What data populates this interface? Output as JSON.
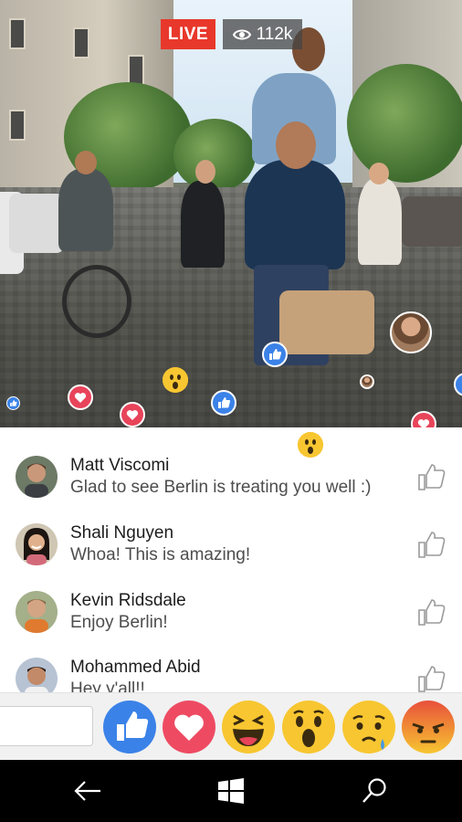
{
  "live": {
    "badge": "LIVE",
    "viewers": "112k"
  },
  "comments": [
    {
      "name": "Matt Viscomi",
      "text": "Glad to see Berlin is treating you well :)",
      "skin": "#c9987a",
      "hair": "#5a3b2a",
      "bg": "#6d7a66"
    },
    {
      "name": "Shali Nguyen",
      "text": "Whoa! This is amazing!",
      "skin": "#e0b08c",
      "hair": "#1c1410",
      "bg": "#cfc6b3"
    },
    {
      "name": "Kevin Ridsdale",
      "text": "Enjoy Berlin!",
      "skin": "#d4a584",
      "hair": "#8a6a4a",
      "bg": "#a3b08a"
    },
    {
      "name": "Mohammed Abid",
      "text": "Hey y'all!!",
      "skin": "#c28a68",
      "hair": "#241a14",
      "bg": "#b7c3d3"
    }
  ],
  "composer": {
    "placeholder": ""
  },
  "reactions": [
    {
      "name": "Like",
      "color": "#3b82e8"
    },
    {
      "name": "Love",
      "color": "#ee4b63"
    },
    {
      "name": "Haha",
      "color": "#f7c631"
    },
    {
      "name": "Wow",
      "color": "#f7c631"
    },
    {
      "name": "Sad",
      "color": "#f7c631"
    },
    {
      "name": "Angry",
      "color": "#ef6a38"
    }
  ],
  "colors": {
    "live": "#e8382b",
    "like": "#3b82e8",
    "love": "#e8445a",
    "emoji": "#f7c631"
  },
  "nav": {
    "back": "back-arrow-icon",
    "start": "windows-logo-icon",
    "search": "search-icon"
  }
}
